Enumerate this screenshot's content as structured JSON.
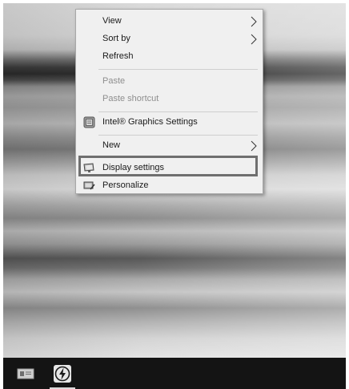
{
  "context_menu": {
    "items": [
      {
        "label": "View",
        "has_submenu": true,
        "enabled": true
      },
      {
        "label": "Sort by",
        "has_submenu": true,
        "enabled": true
      },
      {
        "label": "Refresh",
        "has_submenu": false,
        "enabled": true
      },
      {
        "label": "Paste",
        "has_submenu": false,
        "enabled": false
      },
      {
        "label": "Paste shortcut",
        "has_submenu": false,
        "enabled": false
      },
      {
        "label": "Intel® Graphics Settings",
        "has_submenu": false,
        "enabled": true,
        "icon": "intel-graphics-icon"
      },
      {
        "label": "New",
        "has_submenu": true,
        "enabled": true
      },
      {
        "label": "Display settings",
        "has_submenu": false,
        "enabled": true,
        "icon": "display-icon",
        "highlighted": true
      },
      {
        "label": "Personalize",
        "has_submenu": false,
        "enabled": true,
        "icon": "personalize-icon"
      }
    ]
  },
  "taskbar": {
    "buttons": [
      {
        "icon": "app-window-icon"
      },
      {
        "icon": "lightning-app-icon",
        "active": true
      }
    ]
  },
  "colors": {
    "menu_bg": "#f0f0f0",
    "disabled_text": "#8e8e8e",
    "highlight_border": "#6f6f6f",
    "taskbar_bg": "#141414"
  }
}
